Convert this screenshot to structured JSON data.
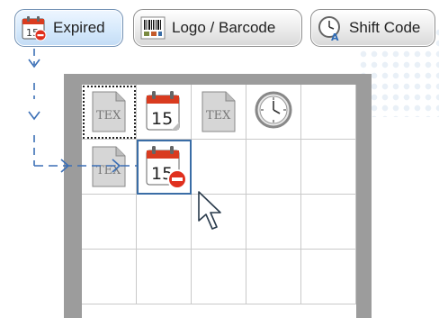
{
  "toolbar": {
    "expired_label": "Expired",
    "logo_barcode_label": "Logo / Barcode",
    "shift_code_label": "Shift Code"
  },
  "icons": {
    "calendar_day": "15",
    "tex_text": "TEX"
  },
  "colors": {
    "selected_button_bg": "#d4e8fb",
    "grid_frame": "#9c9c9c",
    "calendar_red": "#d93b1f",
    "drag_path": "#3b6fb6"
  }
}
